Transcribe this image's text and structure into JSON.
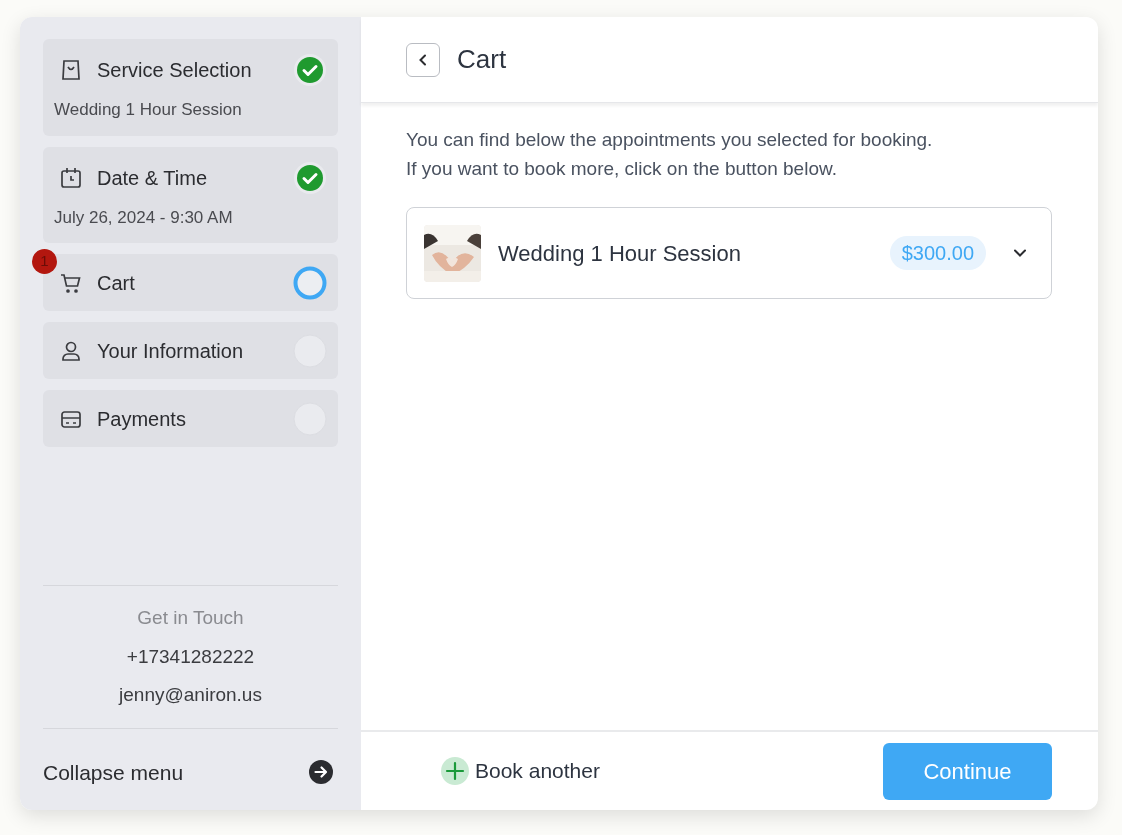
{
  "steps": [
    {
      "label": "Service Selection",
      "detail": "Wedding 1 Hour Session",
      "completed": true,
      "current": false
    },
    {
      "label": "Date & Time",
      "detail": "July 26, 2024 - 9:30 AM",
      "completed": true,
      "current": false
    },
    {
      "label": "Cart",
      "badge": "1",
      "completed": false,
      "current": true
    },
    {
      "label": "Your Information",
      "completed": false,
      "current": false
    },
    {
      "label": "Payments",
      "completed": false,
      "current": false
    }
  ],
  "contact": {
    "heading": "Get in Touch",
    "phone": "+17341282222",
    "email": "jenny@aniron.us"
  },
  "collapse": "Collapse menu",
  "header": {
    "title": "Cart"
  },
  "intro": [
    "You can find below the appointments you selected for booking.",
    "If you want to book more, click on the button below."
  ],
  "items": [
    {
      "name": "Wedding 1 Hour Session",
      "price": "$300.00",
      "expanded": false
    }
  ],
  "footer": {
    "add": "Book another",
    "continue": "Continue"
  }
}
